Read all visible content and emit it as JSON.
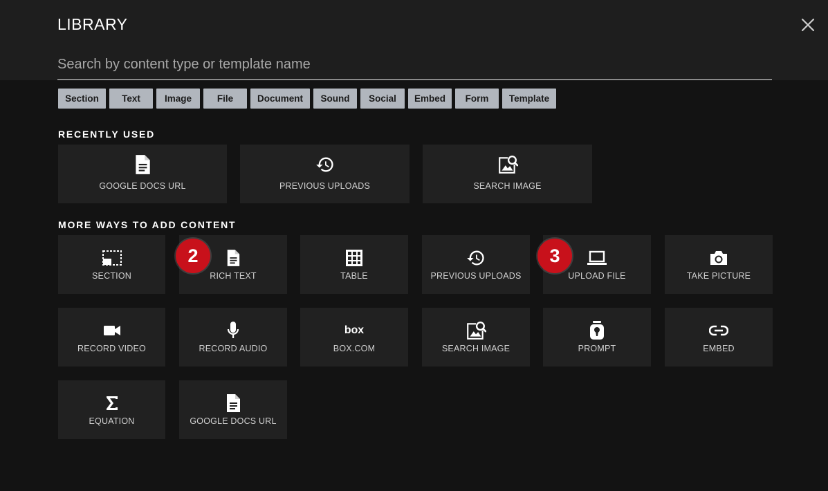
{
  "header": {
    "title": "LIBRARY",
    "close_icon": "close-icon"
  },
  "search": {
    "placeholder": "Search by content type or template name",
    "value": ""
  },
  "filters": [
    "Section",
    "Text",
    "Image",
    "File",
    "Document",
    "Sound",
    "Social",
    "Embed",
    "Form",
    "Template"
  ],
  "recently_used": {
    "heading": "RECENTLY USED",
    "items": [
      {
        "label": "GOOGLE DOCS URL",
        "icon": "document-icon"
      },
      {
        "label": "PREVIOUS UPLOADS",
        "icon": "history-icon"
      },
      {
        "label": "SEARCH IMAGE",
        "icon": "image-search-icon"
      }
    ]
  },
  "more_ways": {
    "heading": "MORE WAYS TO ADD CONTENT",
    "items": [
      {
        "label": "SECTION",
        "icon": "section-icon"
      },
      {
        "label": "RICH TEXT",
        "icon": "document-icon"
      },
      {
        "label": "TABLE",
        "icon": "table-icon"
      },
      {
        "label": "PREVIOUS UPLOADS",
        "icon": "history-icon"
      },
      {
        "label": "UPLOAD FILE",
        "icon": "laptop-icon"
      },
      {
        "label": "TAKE PICTURE",
        "icon": "camera-icon"
      },
      {
        "label": "RECORD VIDEO",
        "icon": "video-camera-icon"
      },
      {
        "label": "RECORD AUDIO",
        "icon": "microphone-icon"
      },
      {
        "label": "BOX.COM",
        "icon": "box-logo-icon",
        "logo_text": "box"
      },
      {
        "label": "SEARCH IMAGE",
        "icon": "image-search-icon"
      },
      {
        "label": "PROMPT",
        "icon": "prompt-icon"
      },
      {
        "label": "EMBED",
        "icon": "link-icon"
      },
      {
        "label": "EQUATION",
        "icon": "sigma-icon"
      },
      {
        "label": "GOOGLE DOCS URL",
        "icon": "document-icon"
      }
    ]
  },
  "callouts": [
    {
      "number": "2",
      "target": "RICH TEXT"
    },
    {
      "number": "3",
      "target": "UPLOAD FILE"
    }
  ],
  "colors": {
    "background": "#131313",
    "header_band": "#1e1e1e",
    "tile": "#212121",
    "chip": "#b1b6bd",
    "badge": "#c8111b"
  }
}
